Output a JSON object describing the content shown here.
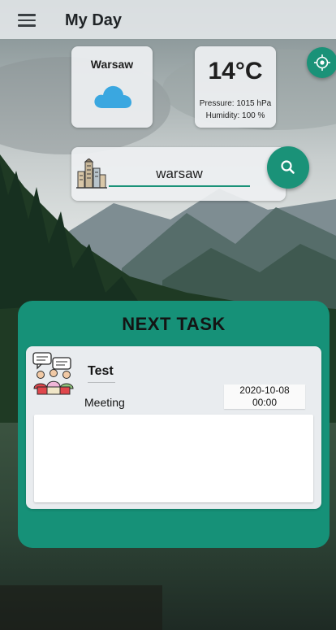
{
  "app": {
    "title": "My Day"
  },
  "weather": {
    "city": "Warsaw",
    "temperature": "14°C",
    "pressure": "Pressure: 1015 hPa",
    "humidity": "Humidity: 100 %",
    "condition_icon": "cloud-icon"
  },
  "search": {
    "value": "warsaw",
    "building_icon": "city-buildings-icon",
    "button_icon": "search-icon"
  },
  "location": {
    "button_icon": "location-icon"
  },
  "next_task": {
    "heading": "NEXT TASK",
    "title": "Test",
    "category": "Meeting",
    "date": "2020-10-08",
    "time": "00:00",
    "description": "",
    "icon": "meeting-icon"
  },
  "colors": {
    "accent": "#1a9278",
    "panel": "#169178",
    "card": "#eef0f2",
    "cloud": "#3aa7e0"
  }
}
